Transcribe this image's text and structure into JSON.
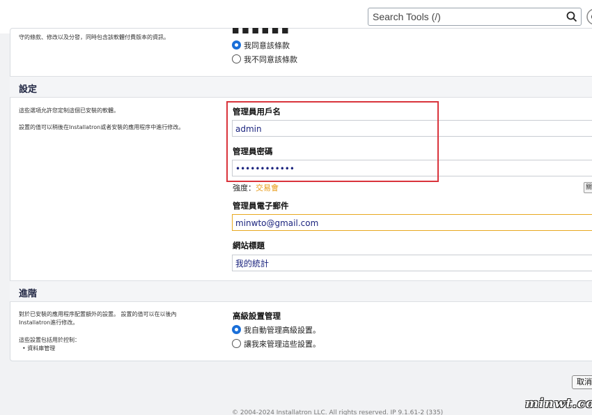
{
  "topbar": {
    "search_placeholder": "Search Tools (/)"
  },
  "license": {
    "desc": "守的條款、修改以及分發，同時包含該軟體付費版本的資訊。",
    "options": [
      "我同意該條款",
      "我不同意該條款"
    ],
    "selected": 0
  },
  "settings": {
    "title": "設定",
    "desc1": "這些選項允許您定制這個已安裝的軟體。",
    "desc2": "設置的值可以稍後在Installatron或者安裝的應用程序中進行修改。",
    "admin_user_label": "管理員用戶名",
    "admin_user_value": "admin",
    "admin_pass_label": "管理員密碼",
    "admin_pass_value": "••••••••••••",
    "strength_label": "強度：",
    "strength_value": "交易會",
    "email_label": "管理員電子郵件",
    "email_value": "minwto@gmail.com",
    "site_title_label": "網站標題",
    "site_title_value": "我的統計"
  },
  "advanced": {
    "title": "進階",
    "desc1": "對於已安裝的應用程序配置額外的設置。 設置的值可以在以後內",
    "desc2": "Installatron進行修改。",
    "desc3": "這些設置包括用於控制：",
    "desc4": "• 資料庫管理",
    "manage_label": "高級設置管理",
    "options": [
      "我自動管理高級設置。",
      "讓我來管理這些設置。"
    ],
    "selected": 0
  },
  "buttons": {
    "generate": "關",
    "cancel": "取消"
  },
  "footer": {
    "text": "© 2004-2024 Installatron LLC. All rights reserved. IP 9.1.61-2 (335)"
  },
  "watermark": "minwt.com",
  "colors": {
    "accent_blue": "#1a6fd8",
    "highlight_red": "#d9333b",
    "focus_orange": "#e8a91f",
    "strength_orange": "#e89a16"
  }
}
